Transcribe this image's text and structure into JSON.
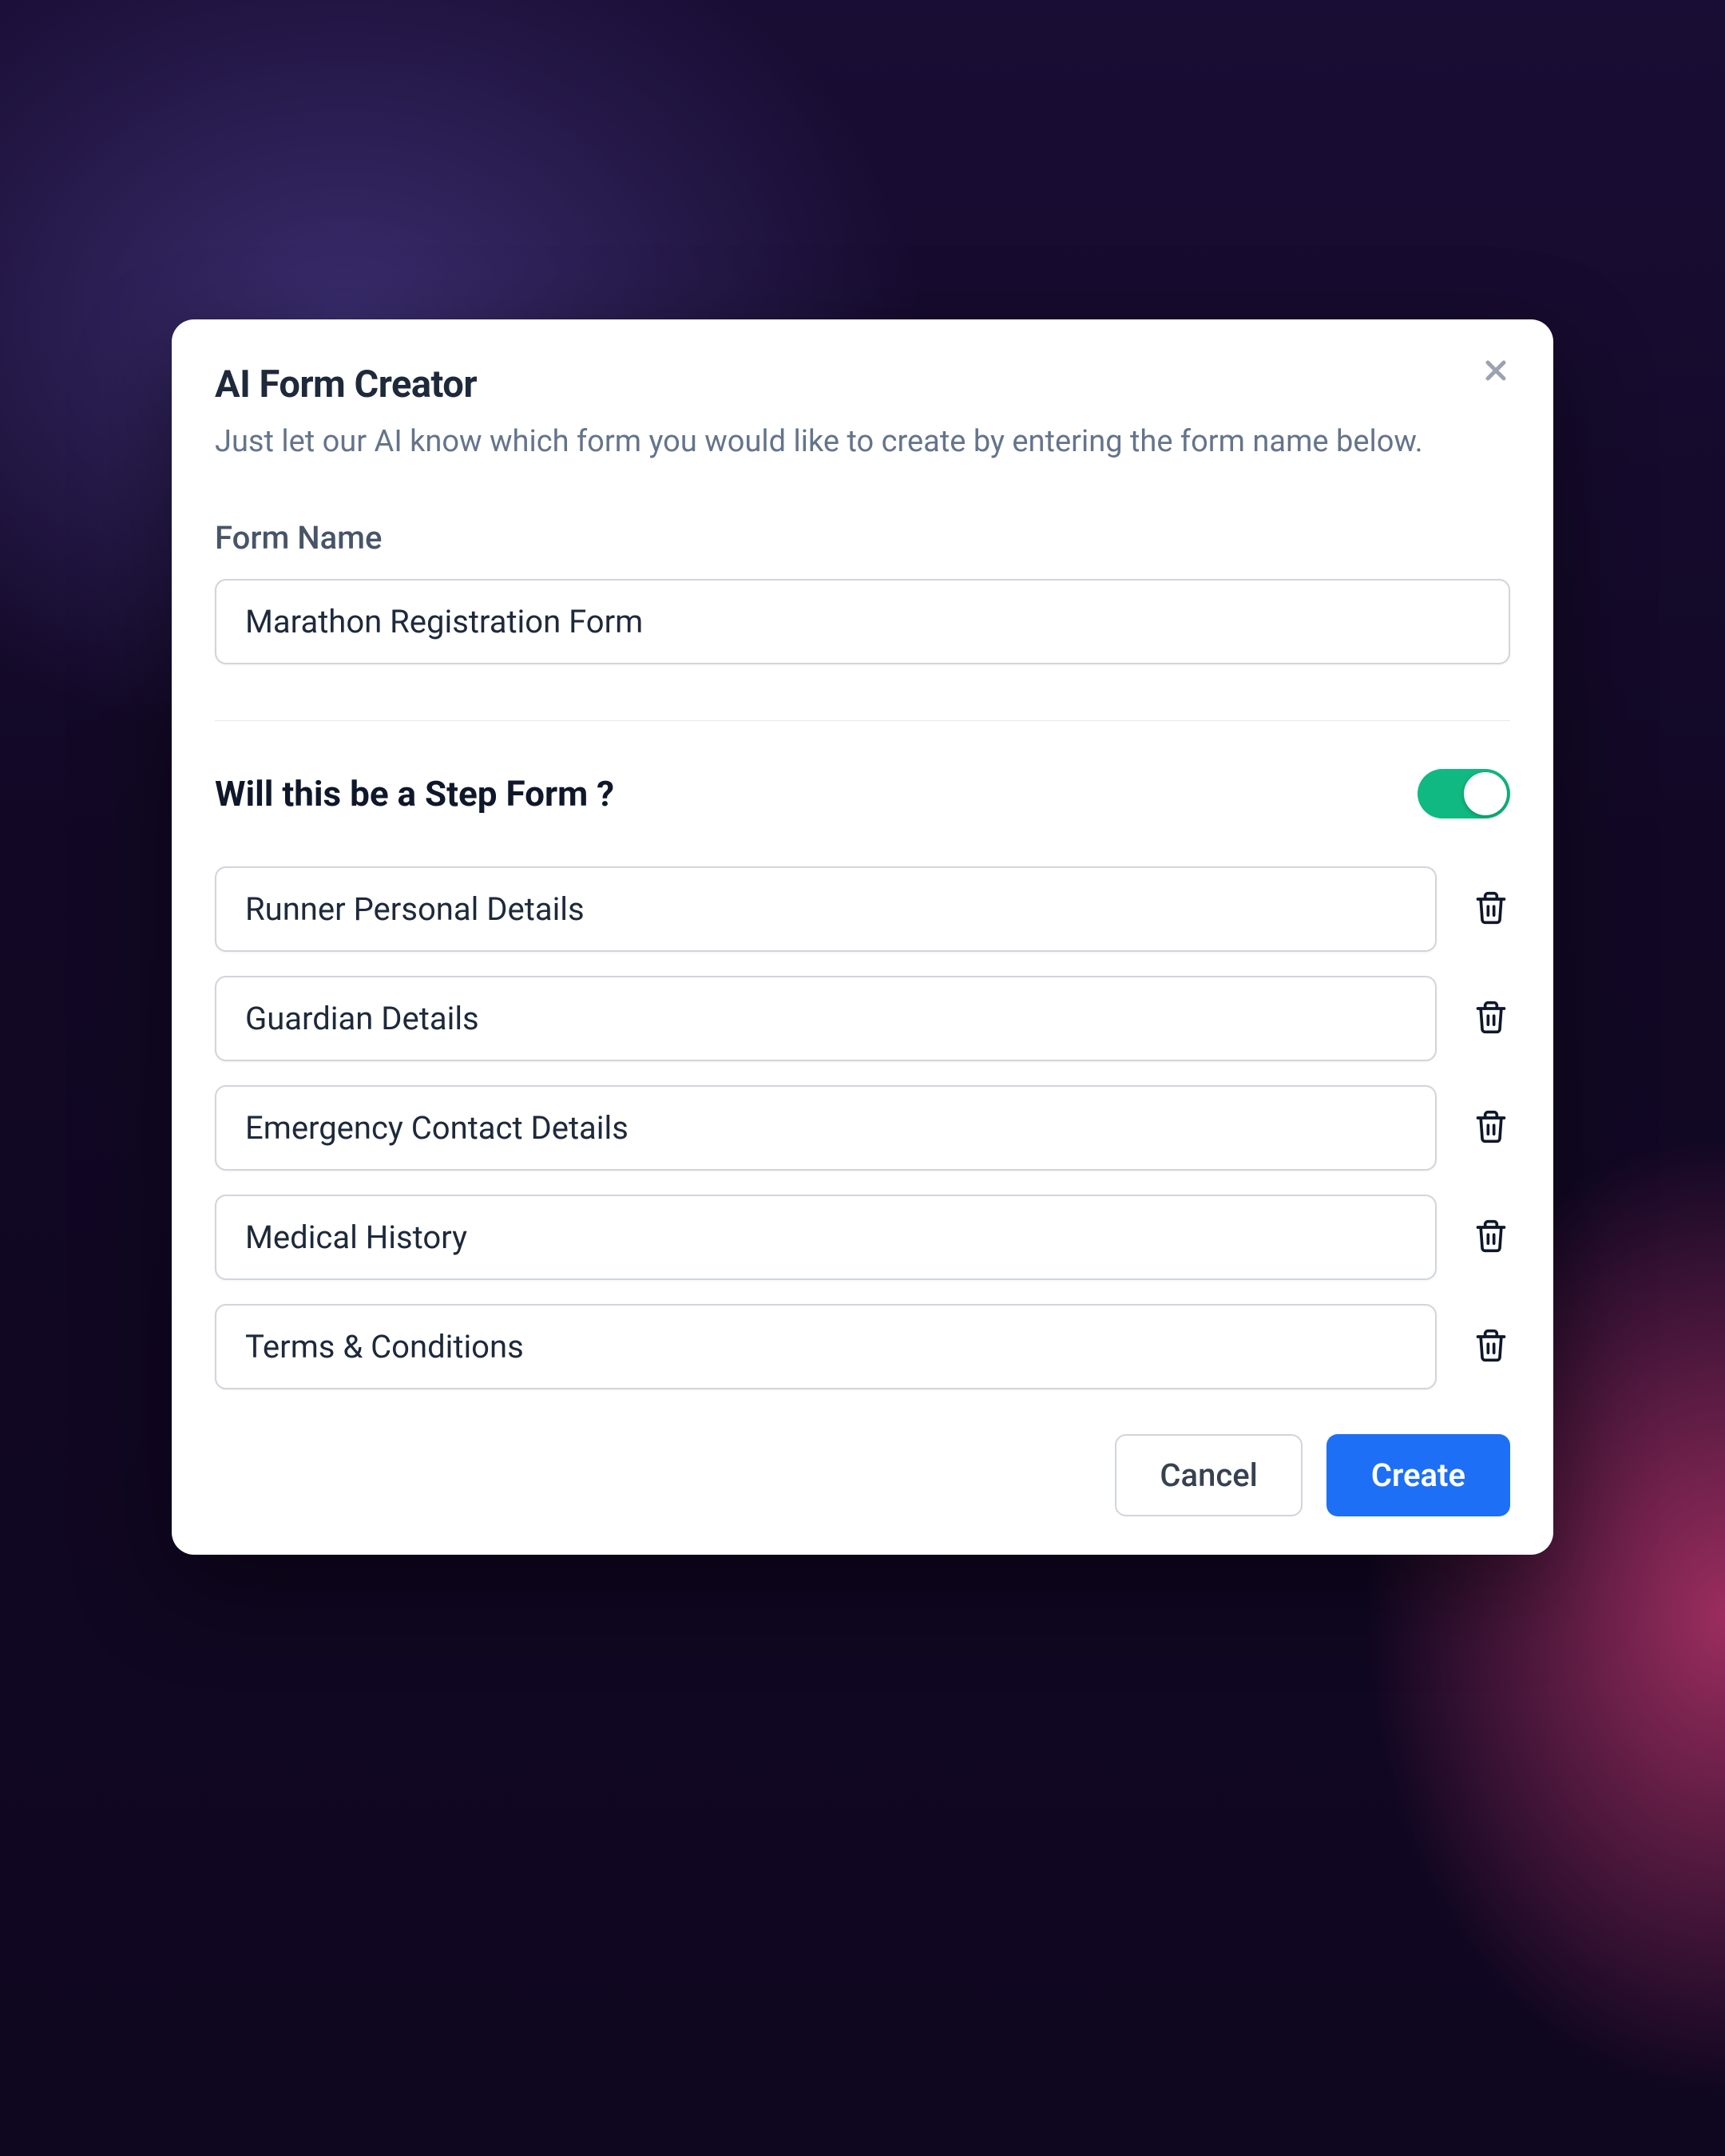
{
  "modal": {
    "title": "AI Form Creator",
    "subtitle": "Just let our AI know which form you would like to create by entering the form name below.",
    "close_label": "Close"
  },
  "form_name": {
    "label": "Form Name",
    "value": "Marathon Registration Form",
    "placeholder": ""
  },
  "step_form": {
    "question": "Will this be a Step Form ?",
    "enabled": true
  },
  "steps": [
    {
      "value": "Runner Personal Details"
    },
    {
      "value": "Guardian Details"
    },
    {
      "value": "Emergency Contact Details"
    },
    {
      "value": "Medical History"
    },
    {
      "value": "Terms & Conditions"
    }
  ],
  "footer": {
    "cancel_label": "Cancel",
    "create_label": "Create"
  },
  "colors": {
    "primary": "#1d6ff5",
    "toggle_on": "#10b981"
  }
}
